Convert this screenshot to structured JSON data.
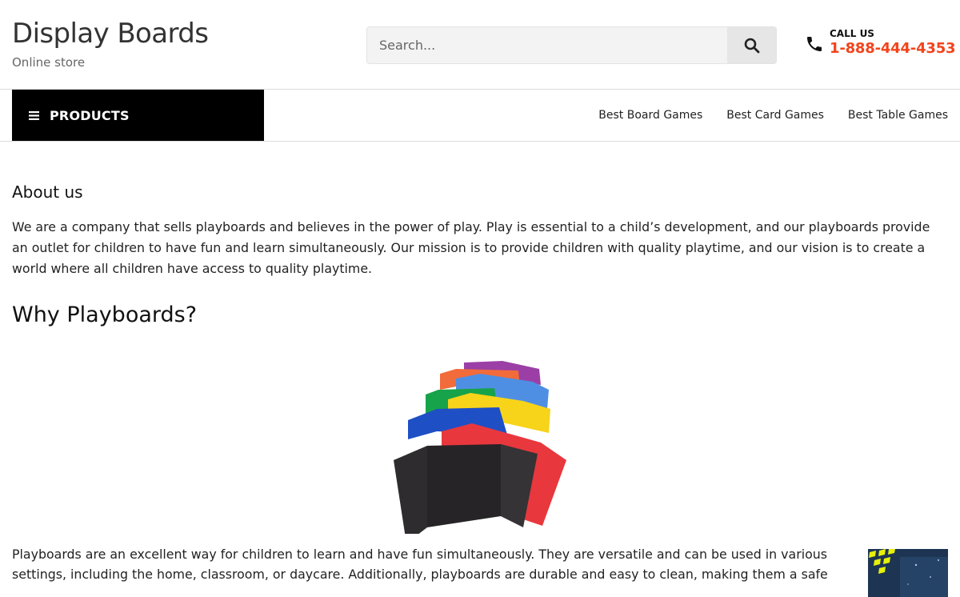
{
  "header": {
    "site_title": "Display Boards",
    "tagline": "Online store",
    "search": {
      "placeholder": "Search...",
      "value": ""
    },
    "call_us": {
      "label": "CALL US",
      "number": "1-888-444-4353"
    }
  },
  "nav": {
    "products_label": "PRODUCTS",
    "links": [
      "Best Board Games",
      "Best Card Games",
      "Best Table Games"
    ]
  },
  "about": {
    "heading": "About us",
    "body": "We are a company that sells playboards and believes in the power of play. Play is essential to a child’s development, and our playboards provide an outlet for children to have fun and learn simultaneously. Our mission is to provide children with quality playtime, and our vision is to create a world where all children have access to quality playtime."
  },
  "why": {
    "heading": "Why Playboards?",
    "body": "Playboards are an excellent way for children to learn and have fun simultaneously. They are versatile and can be used in various settings, including the home, classroom, or daycare. Additionally, playboards are durable and easy to clean, making them a safe"
  },
  "colors": {
    "accent": "#f3441c",
    "nav_bg": "#000000",
    "board_colors": [
      "#9b3fa6",
      "#f26b3a",
      "#4f8fe3",
      "#17a34a",
      "#f7d31a",
      "#1e4fc4",
      "#e8383d",
      "#2b2b2b"
    ]
  },
  "icons": {
    "search": "search-icon",
    "phone": "phone-icon",
    "menu": "menu-icon"
  }
}
